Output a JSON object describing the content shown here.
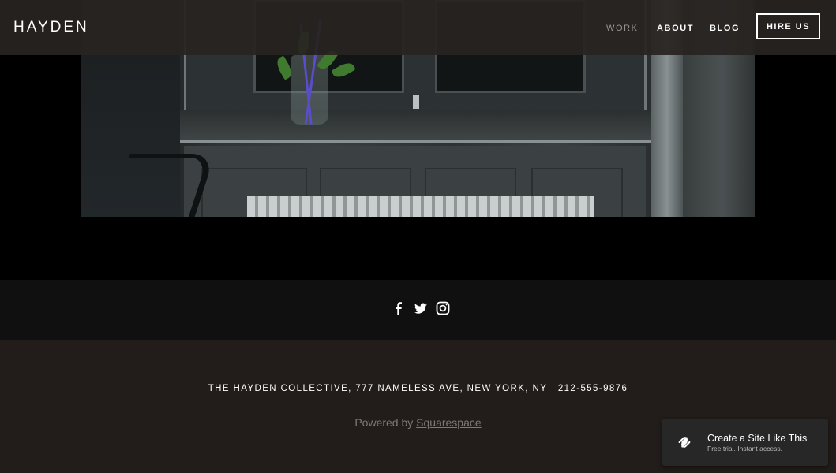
{
  "header": {
    "logo": "HAYDEN",
    "nav": [
      {
        "label": "WORK",
        "active": true
      },
      {
        "label": "ABOUT",
        "active": false
      },
      {
        "label": "BLOG",
        "active": false
      }
    ],
    "cta_label": "HIRE US"
  },
  "hero": {
    "image_subject": "window-with-flowers-photo"
  },
  "social": {
    "icons": [
      "facebook-icon",
      "twitter-icon",
      "instagram-icon"
    ]
  },
  "footer": {
    "address": "THE HAYDEN COLLECTIVE, 777 NAMELESS AVE, NEW YORK, NY   212-555-9876",
    "powered_prefix": "Powered by ",
    "powered_link": "Squarespace"
  },
  "badge": {
    "title": "Create a Site Like This",
    "subtitle": "Free trial. Instant access."
  },
  "colors": {
    "header_bg": "#282321",
    "social_bg": "#111010",
    "footer_bg": "#221d1a",
    "nav_active": "#9a958f"
  }
}
